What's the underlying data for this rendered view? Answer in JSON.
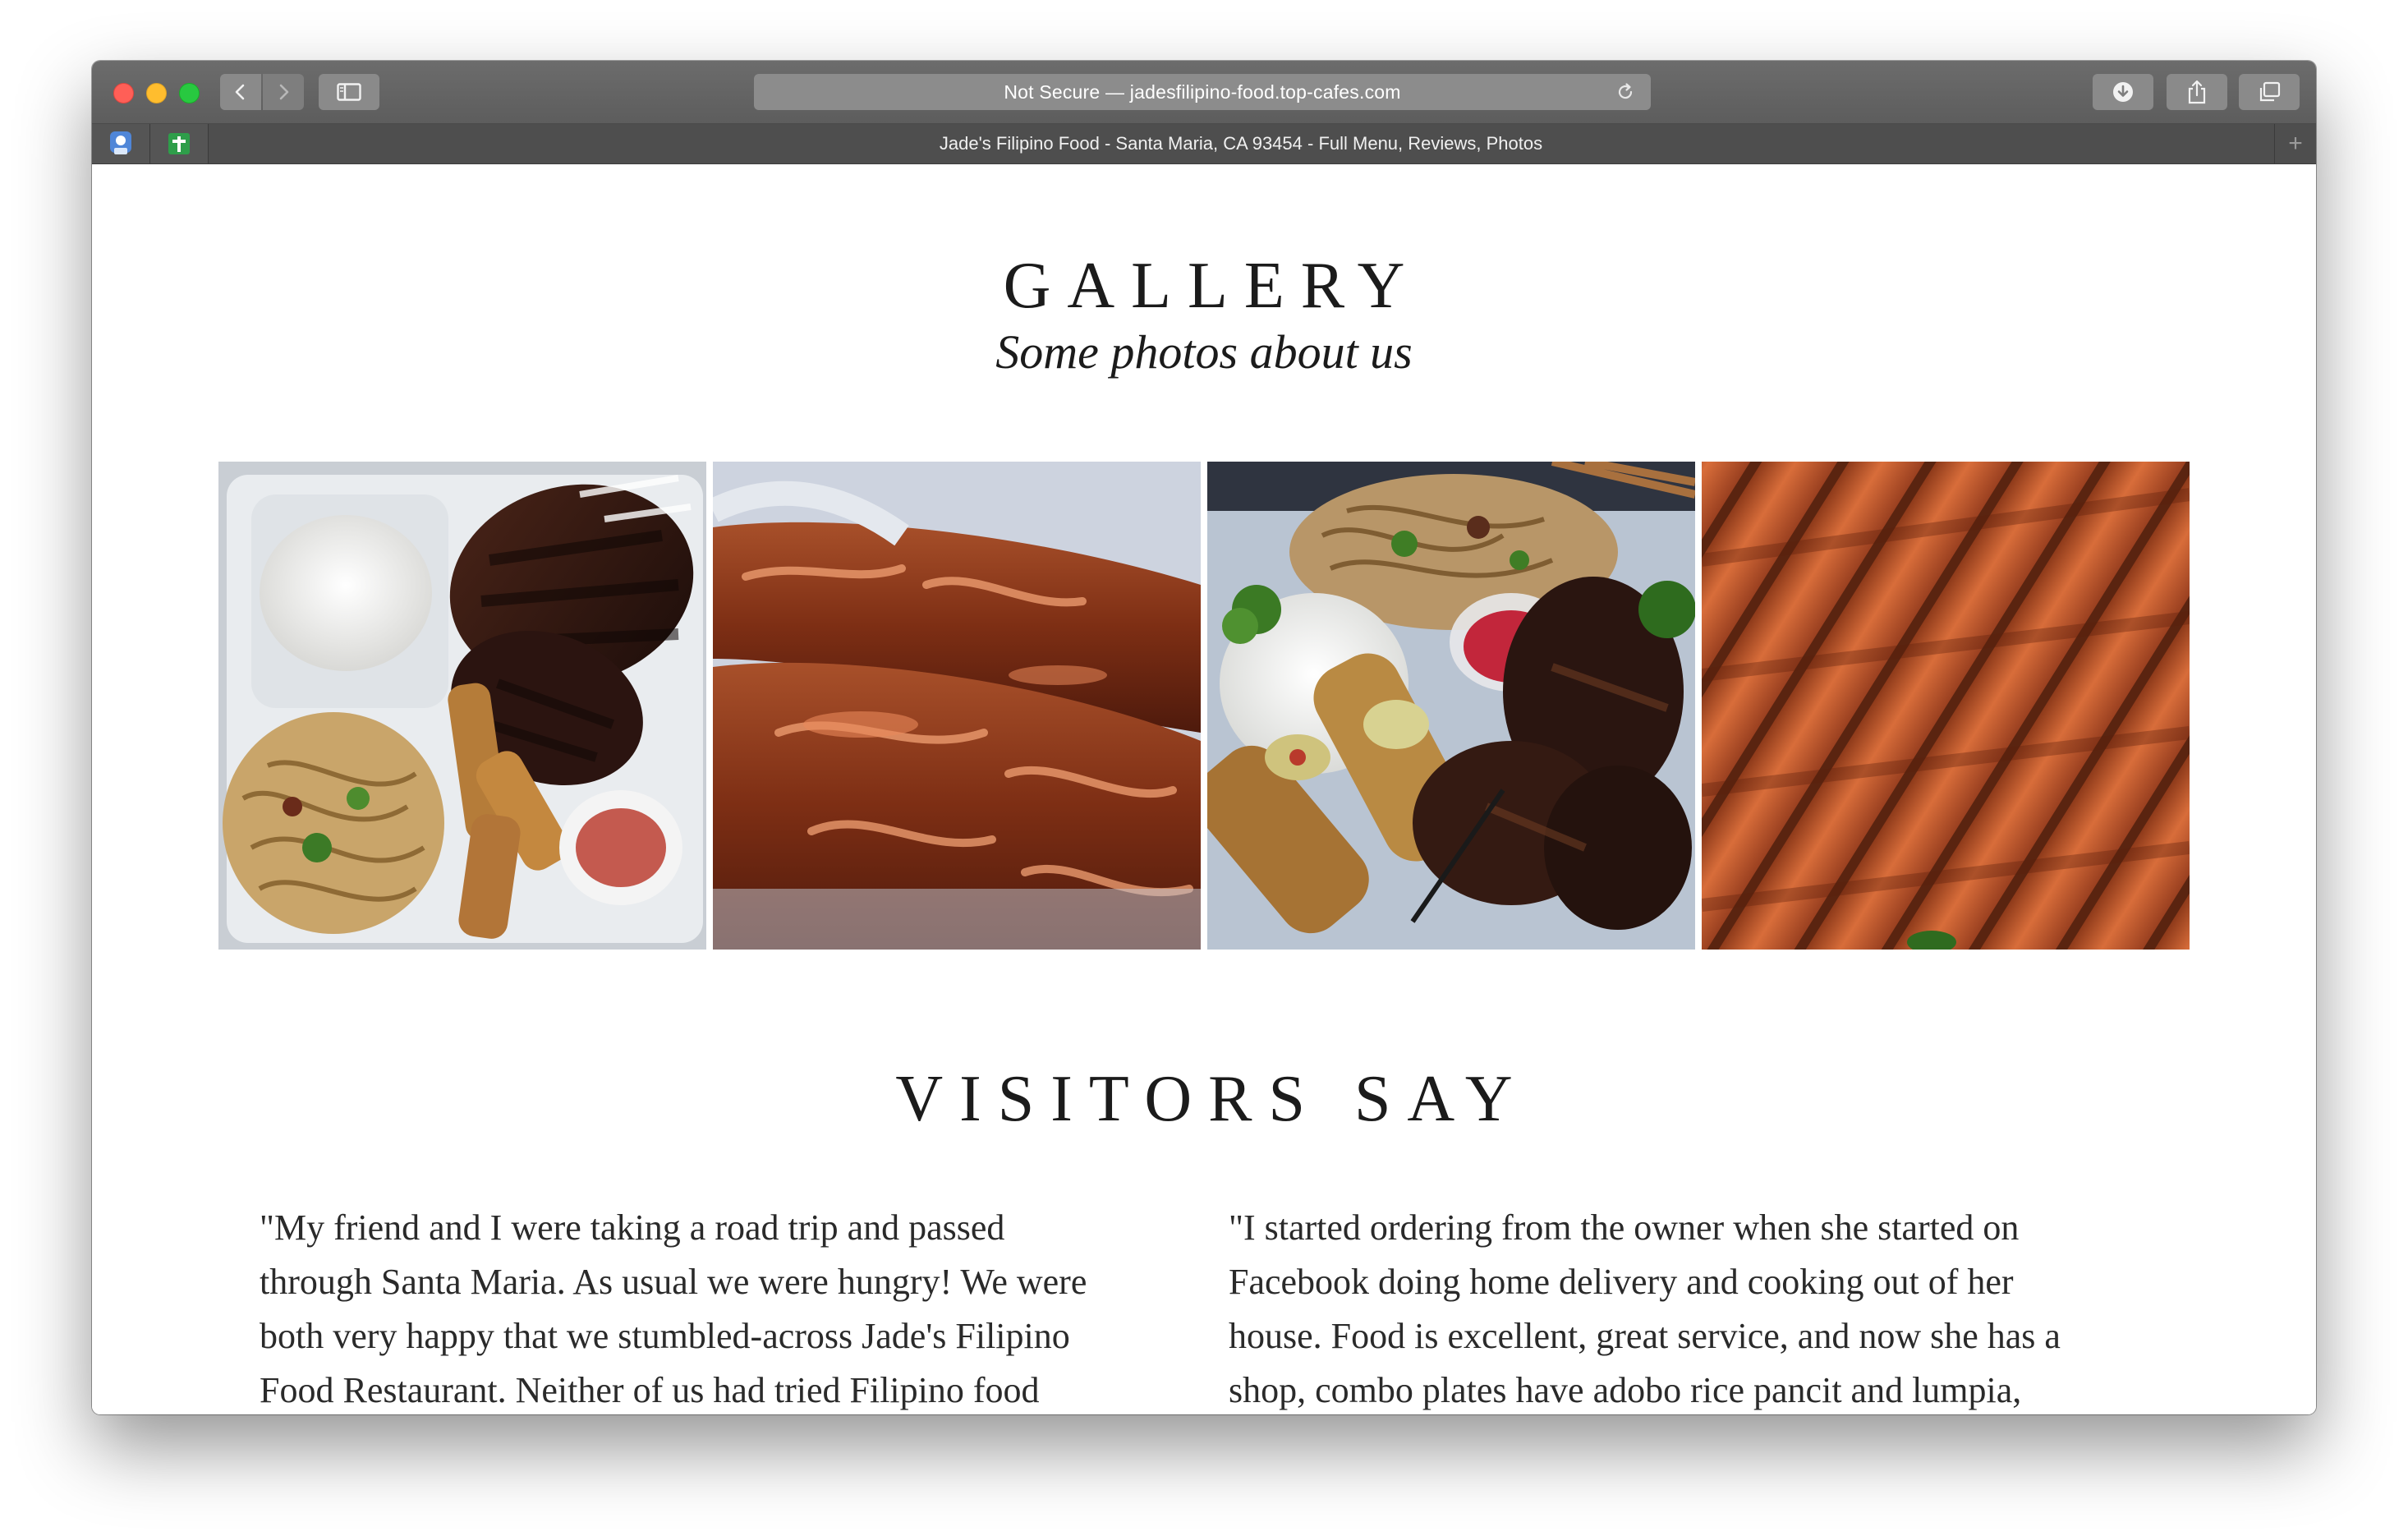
{
  "browser": {
    "address": "Not Secure — jadesfilipino-food.top-cafes.com",
    "tab_title": "Jade's Filipino Food - Santa Maria, CA 93454 - Full Menu, Reviews, Photos",
    "new_tab": "+"
  },
  "gallery": {
    "title": "GALLERY",
    "subtitle": "Some photos about us",
    "photos": [
      {
        "name": "gallery-photo-bbq-plate"
      },
      {
        "name": "gallery-photo-glazed-rolls"
      },
      {
        "name": "gallery-photo-combo-plate"
      },
      {
        "name": "gallery-photo-lumpia"
      }
    ]
  },
  "visitors": {
    "title": "VISITORS SAY",
    "reviews": [
      {
        "text": "\"My friend and I were taking a road trip and passed through Santa Maria. As usual we were hungry! We were both very happy that we stumbled-across Jade's Filipino Food Restaurant. Neither of us had tried Filipino food before and"
      },
      {
        "text": "\"I started ordering from the owner when she started on Facebook doing home delivery and cooking out of her house. Food is excellent, great service, and now she has a shop, combo plates have adobo rice pancit and lumpia, price is on"
      }
    ]
  },
  "colors": {
    "toolbar": "#666666",
    "tabbar": "#4e4e4e",
    "page_bg": "#ffffff",
    "heading": "#1b1b1b"
  }
}
